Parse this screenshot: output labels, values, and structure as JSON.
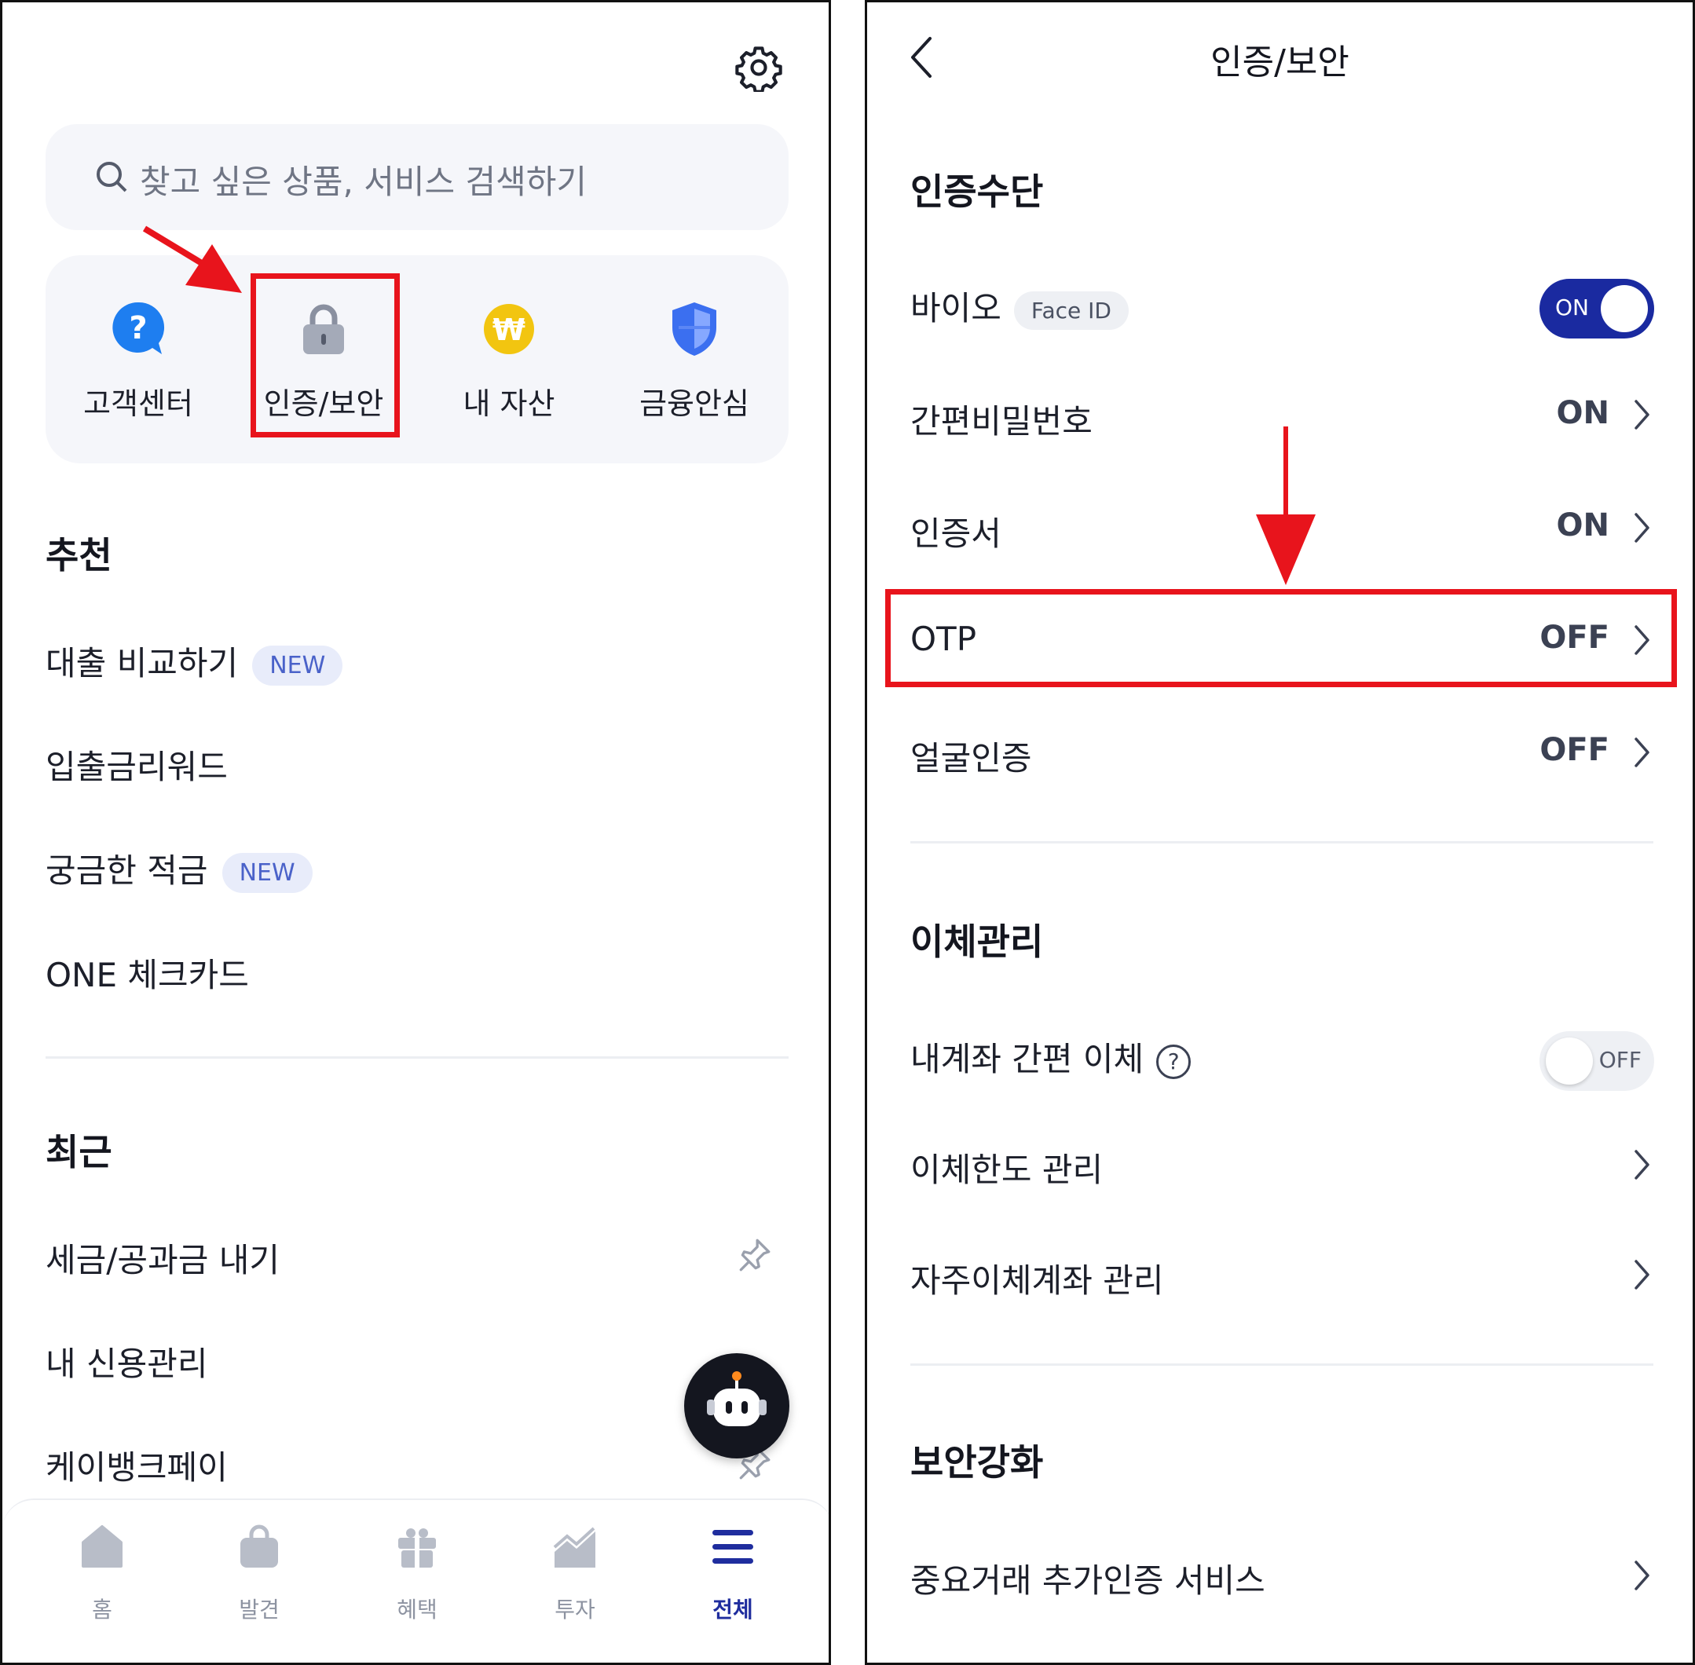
{
  "left": {
    "search": {
      "placeholder": "찾고 싶은 상품, 서비스 검색하기"
    },
    "quick_menu": [
      {
        "label": "고객센터",
        "icon": "question-bubble-icon"
      },
      {
        "label": "인증/보안",
        "icon": "lock-icon"
      },
      {
        "label": "내 자산",
        "icon": "won-coin-icon"
      },
      {
        "label": "금융안심",
        "icon": "shield-icon"
      }
    ],
    "recommended": {
      "title": "추천",
      "items": [
        {
          "label": "대출 비교하기",
          "badge": "NEW"
        },
        {
          "label": "입출금리워드"
        },
        {
          "label": "궁금한 적금",
          "badge": "NEW"
        },
        {
          "label": "ONE 체크카드"
        }
      ]
    },
    "recent": {
      "title": "최근",
      "items": [
        {
          "label": "세금/공과금 내기"
        },
        {
          "label": "내 신용관리"
        },
        {
          "label": "케이뱅크페이"
        }
      ]
    },
    "tabbar": [
      {
        "label": "홈",
        "icon": "home-icon"
      },
      {
        "label": "발견",
        "icon": "shopping-bag-icon"
      },
      {
        "label": "혜택",
        "icon": "gift-icon"
      },
      {
        "label": "투자",
        "icon": "chart-icon"
      },
      {
        "label": "전체",
        "icon": "menu-icon",
        "active": true
      }
    ]
  },
  "right": {
    "title": "인증/보안",
    "auth_section": {
      "title": "인증수단",
      "bio": {
        "label": "바이오",
        "badge": "Face ID",
        "toggle": "ON"
      },
      "items": [
        {
          "label": "간편비밀번호",
          "value": "ON"
        },
        {
          "label": "인증서",
          "value": "ON"
        },
        {
          "label": "OTP",
          "value": "OFF"
        },
        {
          "label": "얼굴인증",
          "value": "OFF"
        }
      ]
    },
    "transfer_section": {
      "title": "이체관리",
      "simple_transfer": {
        "label": "내계좌 간편 이체",
        "help": "?",
        "toggle": "OFF"
      },
      "items": [
        {
          "label": "이체한도 관리"
        },
        {
          "label": "자주이체계좌 관리"
        }
      ]
    },
    "security_section": {
      "title": "보안강화",
      "items": [
        {
          "label": "중요거래 추가인증 서비스"
        }
      ]
    }
  },
  "colors": {
    "highlight": "#e8141c",
    "toggle_on": "#1a2aa0",
    "tab_active": "#1f2d9e",
    "badge_bg": "#e8ecfa",
    "badge_text": "#4a62c9"
  }
}
